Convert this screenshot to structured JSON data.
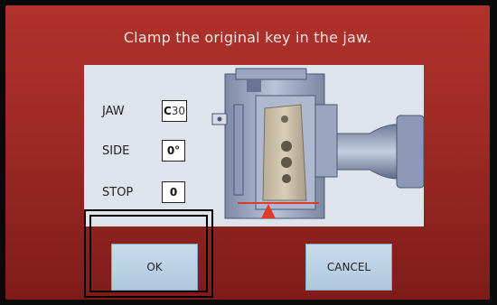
{
  "instruction": "Clamp the original key in the jaw.",
  "settings": [
    {
      "label": "JAW",
      "value": "C",
      "value_suffix": "30"
    },
    {
      "label": "SIDE",
      "value": "0°"
    },
    {
      "label": "STOP",
      "value": "0"
    }
  ],
  "buttons": {
    "ok": "OK",
    "cancel": "CANCEL"
  },
  "colors": {
    "background": "#a12a25",
    "panel": "#dfe4ec",
    "button": "#bcd3e8",
    "stop_marker": "#e03b2a"
  }
}
